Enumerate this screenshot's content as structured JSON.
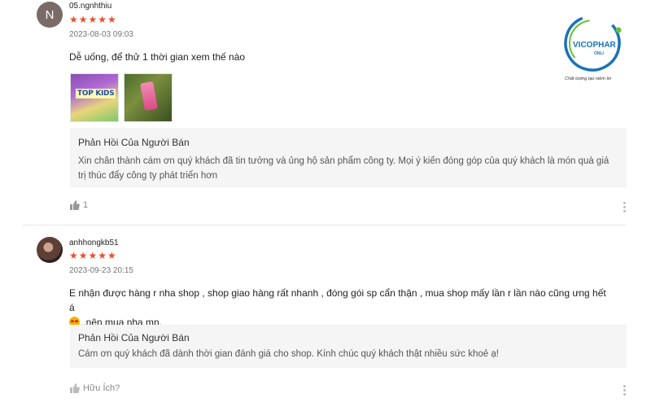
{
  "reviews": [
    {
      "avatar_letter": "N",
      "username": "05.ngnhthiu",
      "stars": "★★★★★",
      "datetime": "2023-08-03 09:03",
      "content": "Dễ uống, để thử 1 thời gian xem thế nào",
      "images": [
        {
          "text": "TOP KIDS"
        },
        {
          "text": ""
        }
      ],
      "reply_title": "Phản Hồi Của Người Bán",
      "reply_text": "Xin chân thành cám ơn quý khách đã tin tưởng và ủng hộ sản phẩm công ty. Mọi ý kiến đóng góp của quý khách là món quà giá trị thúc đẩy công ty phát triển hơn",
      "like_label": "1"
    },
    {
      "username": "anhhongkb51",
      "stars": "★★★★★",
      "datetime": "2023-09-23 20:15",
      "content_line1": "E nhận được hàng r nha shop , shop giao hàng rất nhanh , đóng gói sp cẩn thận , mua shop mấy lần r lần nào cũng ưng hết á",
      "content_line2": "..nên mua nha mn.",
      "reply_title": "Phản Hồi Của Người Bán",
      "reply_text": "Cám ơn quý khách đã dành thời gian đánh giá cho shop. Kính chúc quý khách thật nhiều sức khoẻ ạ!",
      "like_label": "Hữu Ích?"
    }
  ],
  "logo": {
    "brand": "VICOPHAR",
    "sub": "ONLI",
    "tagline": "Chất lượng tạo niềm tin"
  },
  "colors": {
    "star": "#ee4d2d",
    "logo_blue": "#1a73b8",
    "logo_green": "#6abf3a"
  }
}
